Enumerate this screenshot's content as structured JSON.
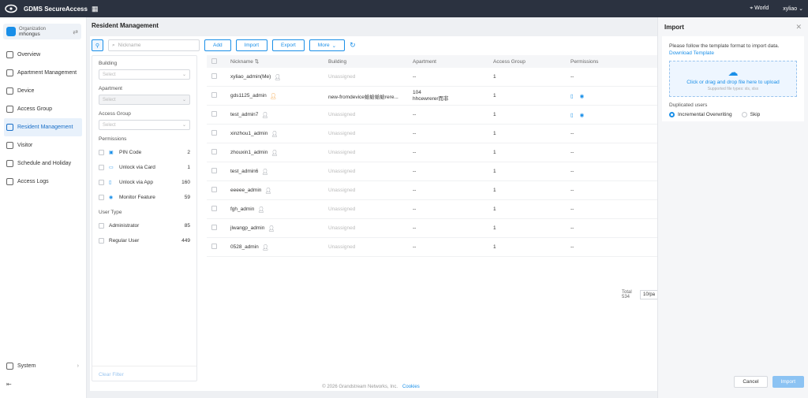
{
  "topbar": {
    "app_title": "GDMS SecureAccess",
    "region": "World",
    "user": "xyliao"
  },
  "sidebar": {
    "org_label": "Organization",
    "org_name": "mhongus",
    "items": [
      {
        "label": "Overview",
        "icon": "overview-icon"
      },
      {
        "label": "Apartment Management",
        "icon": "apartment-icon"
      },
      {
        "label": "Device",
        "icon": "device-icon"
      },
      {
        "label": "Access Group",
        "icon": "access-group-icon"
      },
      {
        "label": "Resident Management",
        "icon": "resident-icon",
        "active": true
      },
      {
        "label": "Visitor",
        "icon": "visitor-icon"
      },
      {
        "label": "Schedule and Holiday",
        "icon": "calendar-icon"
      },
      {
        "label": "Access Logs",
        "icon": "logs-icon"
      }
    ],
    "system_label": "System"
  },
  "main": {
    "title": "Resident Management",
    "search_placeholder": "Nickname",
    "buttons": {
      "add": "Add",
      "import": "Import",
      "export": "Export",
      "more": "More"
    },
    "filter": {
      "building_label": "Building",
      "building_placeholder": "Select",
      "apartment_label": "Apartment",
      "apartment_placeholder": "Select",
      "access_group_label": "Access Group",
      "access_group_placeholder": "Select",
      "permissions_label": "Permissions",
      "permissions": [
        {
          "label": "PIN Code",
          "count": "2"
        },
        {
          "label": "Unlock via Card",
          "count": "1"
        },
        {
          "label": "Unlock via App",
          "count": "160"
        },
        {
          "label": "Monitor Feature",
          "count": "59"
        }
      ],
      "user_type_label": "User Type",
      "user_types": [
        {
          "label": "Administrator",
          "count": "85"
        },
        {
          "label": "Regular User",
          "count": "449"
        }
      ],
      "clear": "Clear Filter"
    },
    "table": {
      "headers": {
        "nickname": "Nickname ⇅",
        "building": "Building",
        "apartment": "Apartment",
        "access_group": "Access Group",
        "permissions": "Permissions"
      },
      "rows": [
        {
          "nickname": "xyliao_admin(Me)",
          "building": "Unassigned",
          "apartment": "--",
          "ag": "1",
          "perm": "--"
        },
        {
          "nickname": "gds1125_admin",
          "building": "new-fromdevice蛤蛤蛤蛤rere...",
          "apartment": "104",
          "apartment2": "hhcewrerer而非",
          "ag": "1",
          "perm": "icons"
        },
        {
          "nickname": "test_admin7",
          "building": "Unassigned",
          "apartment": "--",
          "ag": "1",
          "perm": "icons"
        },
        {
          "nickname": "xinzhou1_admin",
          "building": "Unassigned",
          "apartment": "--",
          "ag": "1",
          "perm": "--"
        },
        {
          "nickname": "zhouxin1_admin",
          "building": "Unassigned",
          "apartment": "--",
          "ag": "1",
          "perm": "--"
        },
        {
          "nickname": "test_admin6",
          "building": "Unassigned",
          "apartment": "--",
          "ag": "1",
          "perm": "--"
        },
        {
          "nickname": "eeeee_admin",
          "building": "Unassigned",
          "apartment": "--",
          "ag": "1",
          "perm": "--"
        },
        {
          "nickname": "fgh_admin",
          "building": "Unassigned",
          "apartment": "--",
          "ag": "1",
          "perm": "--"
        },
        {
          "nickname": "jlwangp_admin",
          "building": "Unassigned",
          "apartment": "--",
          "ag": "1",
          "perm": "--"
        },
        {
          "nickname": "0528_admin",
          "building": "Unassigned",
          "apartment": "--",
          "ag": "1",
          "perm": "--"
        }
      ]
    },
    "pager": {
      "total": "Total 534",
      "page_size": "10/pa"
    },
    "footer": {
      "copyright": "© 2026 Grandstream Networks, Inc.",
      "cookies": "Cookies"
    }
  },
  "drawer": {
    "title": "Import",
    "hint": "Please follow the template format to import data.",
    "download_link": "Download Template",
    "upload_text": "Click or drag and drop file here to upload",
    "upload_sub": "Supported file types: xls, xlsx",
    "dup_label": "Duplicated users",
    "options": [
      "Incremental Overwriting",
      "Skip"
    ],
    "cancel": "Cancel",
    "import": "Import"
  },
  "colors": {
    "accent": "#1a8fe8",
    "topbar": "#2b3240",
    "orange": "#f29d38"
  }
}
